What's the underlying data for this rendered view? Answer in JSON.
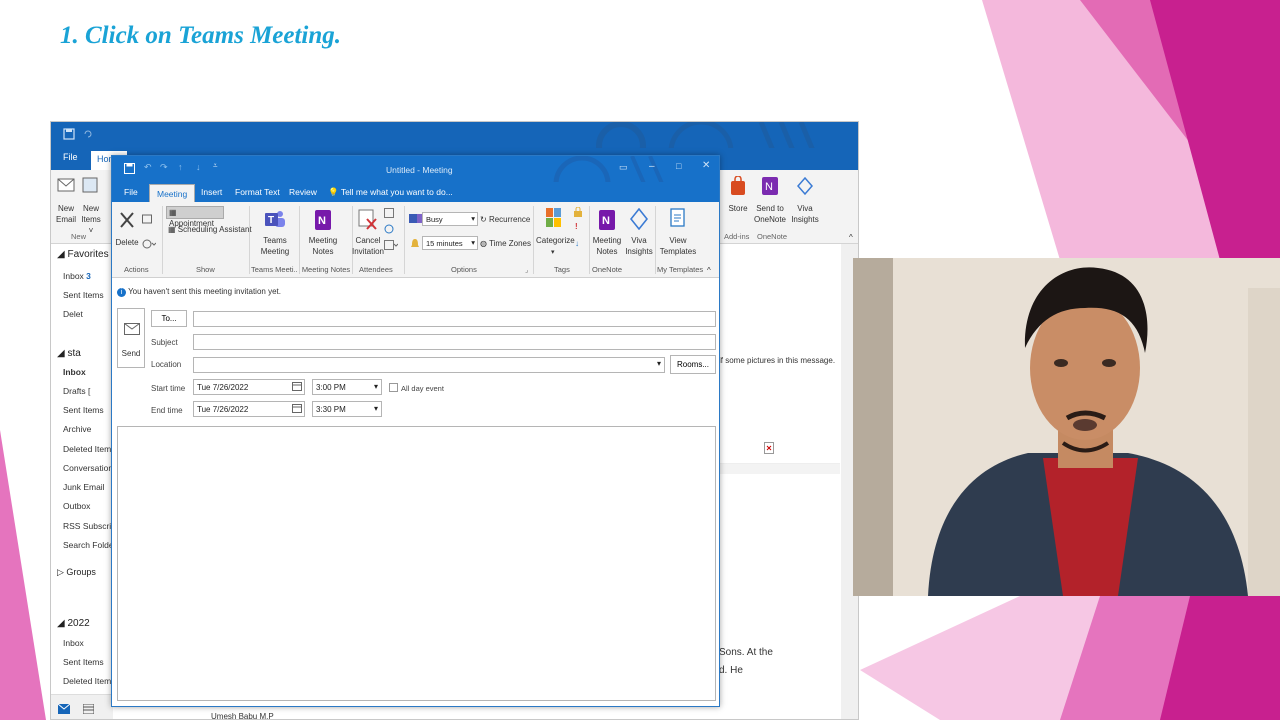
{
  "slide": {
    "title": "1. Click on Teams Meeting."
  },
  "outer": {
    "tabs": {
      "file": "File",
      "home": "Home"
    },
    "ribbon": {
      "new_email": "New Email",
      "new_items": "New Items ˅",
      "new_group": "New",
      "store": "Store",
      "send_to_onenote": "Send to OneNote",
      "viva_insights": "Viva Insights",
      "addins_group": "Add-ins",
      "onenote_group": "OneNote"
    },
    "nav": {
      "favorites": "◢ Favorites",
      "inbox": "Inbox",
      "inbox_count": "3",
      "sent": "Sent Items",
      "deleted": "Delet",
      "account": "◢ sta",
      "inbox2": "Inbox",
      "drafts": "Drafts [",
      "sent2": "Sent Items",
      "archive": "Archive",
      "deleted2": "Deleted Items",
      "conversation": "Conversation H",
      "junk": "Junk Email",
      "outbox": "Outbox",
      "rss": "RSS Subscriptio",
      "search": "Search Folders",
      "groups": "▷ Groups",
      "year": "◢ 2022",
      "inbox3": "Inbox",
      "sent3": "Sent Items",
      "deleted3": "Deleted Items"
    },
    "reading": {
      "pictures_msg": "if some pictures in this message.",
      "text1": "Sons. At the",
      "text2": "d. He",
      "bottom_text": "Umesh Babu M.P"
    }
  },
  "meeting": {
    "window_title": "Untitled - Meeting",
    "tabs": [
      "File",
      "Meeting",
      "Insert",
      "Format Text",
      "Review"
    ],
    "tell_me": "Tell me what you want to do...",
    "ribbon": {
      "delete": "Delete",
      "appointment": "Appointment",
      "scheduling_assistant": "Scheduling Assistant",
      "teams_meeting": "Teams Meeting",
      "meeting_notes": "Meeting Notes",
      "cancel_invitation": "Cancel Invitation",
      "busy": "Busy",
      "recurrence": "Recurrence",
      "reminder": "15 minutes",
      "time_zones": "Time Zones",
      "categorize": "Categorize",
      "meeting_notes2": "Meeting Notes",
      "viva_insights": "Viva Insights",
      "view_templates": "View Templates",
      "groups": {
        "actions": "Actions",
        "show": "Show",
        "teams": "Teams Meeti...",
        "notes": "Meeting Notes",
        "attendees": "Attendees",
        "options": "Options",
        "tags": "Tags",
        "onenote": "OneNote",
        "templates": "My Templates"
      }
    },
    "info_bar": "You haven't sent this meeting invitation yet.",
    "form": {
      "send": "Send",
      "to_button": "To...",
      "subject_label": "Subject",
      "location_label": "Location",
      "rooms_button": "Rooms...",
      "start_label": "Start time",
      "end_label": "End time",
      "start_date": "Tue 7/26/2022",
      "start_time": "3:00 PM",
      "end_date": "Tue 7/26/2022",
      "end_time": "3:30 PM",
      "all_day": "All day event"
    }
  },
  "colors": {
    "outlook_blue": "#1565b8",
    "meeting_blue": "#1771c9",
    "slide_title": "#1aa3d6",
    "pink": "#e36bb5"
  }
}
